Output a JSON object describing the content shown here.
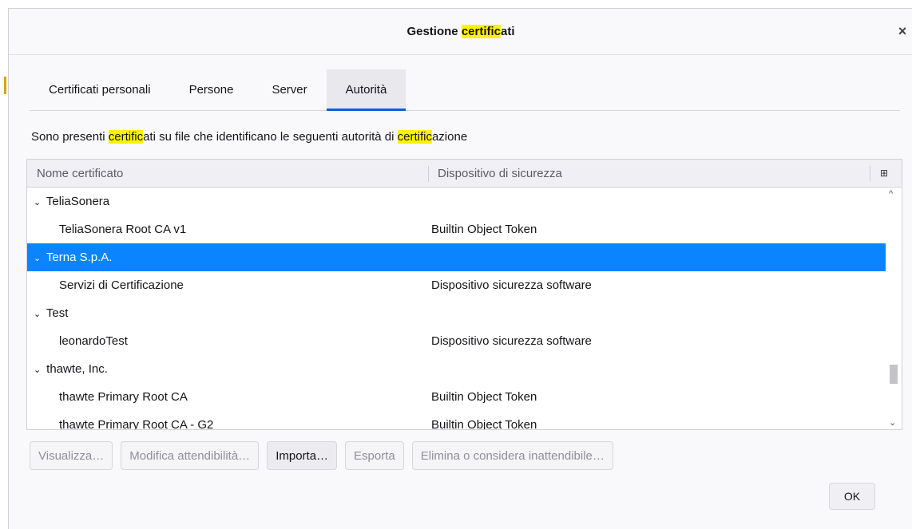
{
  "dialog": {
    "title_prefix": "Gestione ",
    "title_highlight": "certific",
    "title_suffix": "ati",
    "close_glyph": "×"
  },
  "tabs": [
    {
      "label": "Certificati personali",
      "selected": false
    },
    {
      "label": "Persone",
      "selected": false
    },
    {
      "label": "Server",
      "selected": false
    },
    {
      "label": "Autorità",
      "selected": true
    }
  ],
  "description": {
    "part1": "Sono presenti ",
    "hl1": "certific",
    "part2": "ati su file che identificano le seguenti autorità di ",
    "hl2": "certific",
    "part3": "azione"
  },
  "table": {
    "columns": {
      "name": "Nome certificato",
      "device": "Dispositivo di sicurezza"
    },
    "picker_glyph": "⊞",
    "rows": [
      {
        "type": "group",
        "name": "TeliaSonera",
        "device": "",
        "selected": false
      },
      {
        "type": "child",
        "name": "TeliaSonera Root CA v1",
        "device": "Builtin Object Token",
        "selected": false
      },
      {
        "type": "group",
        "name": "Terna S.p.A.",
        "device": "",
        "selected": true
      },
      {
        "type": "child",
        "name": "Servizi di Certificazione",
        "device": "Dispositivo sicurezza software",
        "selected": false
      },
      {
        "type": "group",
        "name": "Test",
        "device": "",
        "selected": false
      },
      {
        "type": "child",
        "name": "leonardoTest",
        "device": "Dispositivo sicurezza software",
        "selected": false
      },
      {
        "type": "group",
        "name": "thawte, Inc.",
        "device": "",
        "selected": false
      },
      {
        "type": "child",
        "name": "thawte Primary Root CA",
        "device": "Builtin Object Token",
        "selected": false
      },
      {
        "type": "child",
        "name": "thawte Primary Root CA - G2",
        "device": "Builtin Object Token",
        "selected": false
      }
    ],
    "twisty_glyph": "⌄",
    "scroll_up_glyph": "^",
    "scroll_down_glyph": "⌄"
  },
  "buttons": {
    "view": "Visualizza…",
    "edit_trust": "Modifica attendibilità…",
    "import": "Importa…",
    "export": "Esporta",
    "delete": "Elimina o considera inattendibile…",
    "ok": "OK"
  }
}
